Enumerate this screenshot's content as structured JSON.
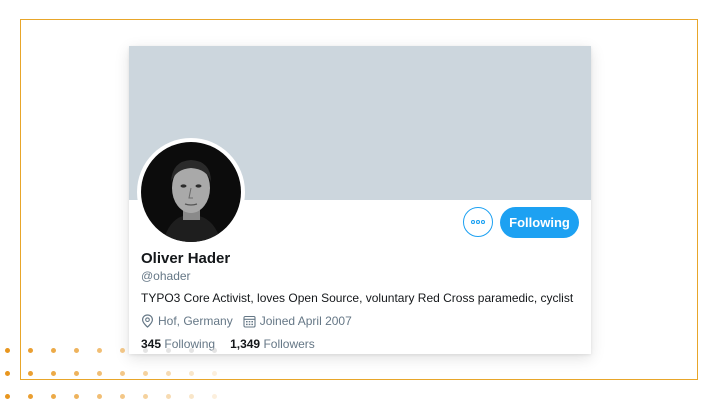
{
  "profile": {
    "name": "Oliver Hader",
    "handle": "@ohader",
    "bio": "TYPO3 Core Activist, loves Open Source, voluntary Red Cross paramedic, cyclist",
    "location": "Hof, Germany",
    "joined": "Joined April 2007",
    "following_count": "345",
    "following_label": "Following",
    "followers_count": "1,349",
    "followers_label": "Followers"
  },
  "actions": {
    "follow_button_label": "Following",
    "more_icon": "more-horizontal-icon"
  },
  "colors": {
    "accent": "#1da1f2",
    "banner": "#ccd6dd",
    "frame_border": "#e8a62a"
  }
}
